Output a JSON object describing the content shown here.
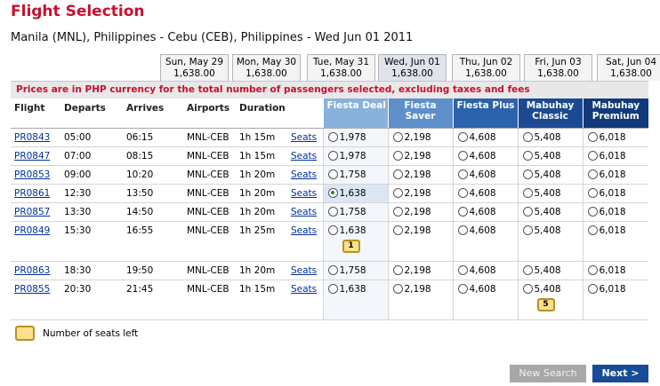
{
  "page": {
    "title": "Flight Selection",
    "route": "Manila (MNL), Philippines - Cebu (CEB), Philippines - Wed Jun 01 2011"
  },
  "date_tabs": [
    {
      "day": "Sun, May 29",
      "price": "1,638.00"
    },
    {
      "day": "Mon, May 30",
      "price": "1,638.00"
    },
    {
      "day": "Tue, May 31",
      "price": "1,638.00"
    },
    {
      "day": "Wed, Jun 01",
      "price": "1,638.00",
      "selected": true
    },
    {
      "day": "Thu, Jun 02",
      "price": "1,638.00"
    },
    {
      "day": "Fri, Jun 03",
      "price": "1,638.00"
    },
    {
      "day": "Sat, Jun 04",
      "price": "1,638.00"
    }
  ],
  "notice": "Prices are in PHP currency for the total number of passengers selected, excluding taxes and fees",
  "columns": {
    "flight": "Flight",
    "departs": "Departs",
    "arrives": "Arrives",
    "airports": "Airports",
    "duration": "Duration",
    "fares": [
      {
        "line1": "Fiesta Deal",
        "line2": "",
        "color": "#8ab0dc"
      },
      {
        "line1": "Fiesta",
        "line2": "Saver",
        "color": "#5e8fcb"
      },
      {
        "line1": "Fiesta Plus",
        "line2": "",
        "color": "#2d62ad"
      },
      {
        "line1": "Mabuhay",
        "line2": "Classic",
        "color": "#1b4a92"
      },
      {
        "line1": "Mabuhay",
        "line2": "Premium",
        "color": "#123a7a"
      }
    ]
  },
  "flights": [
    {
      "flight": "PR0843",
      "departs": "05:00",
      "arrives": "06:15",
      "airports": "MNL-CEB",
      "duration": "1h 15m",
      "seats_label": "Seats",
      "fares": [
        "1,978",
        "2,198",
        "4,608",
        "5,408",
        "6,018"
      ]
    },
    {
      "flight": "PR0847",
      "departs": "07:00",
      "arrives": "08:15",
      "airports": "MNL-CEB",
      "duration": "1h 15m",
      "seats_label": "Seats",
      "fares": [
        "1,978",
        "2,198",
        "4,608",
        "5,408",
        "6,018"
      ]
    },
    {
      "flight": "PR0853",
      "departs": "09:00",
      "arrives": "10:20",
      "airports": "MNL-CEB",
      "duration": "1h 20m",
      "seats_label": "Seats",
      "fares": [
        "1,758",
        "2,198",
        "4,608",
        "5,408",
        "6,018"
      ]
    },
    {
      "flight": "PR0861",
      "departs": "12:30",
      "arrives": "13:50",
      "airports": "MNL-CEB",
      "duration": "1h 20m",
      "seats_label": "Seats",
      "fares": [
        "1,638",
        "2,198",
        "4,608",
        "5,408",
        "6,018"
      ],
      "selected_fare": 0
    },
    {
      "flight": "PR0857",
      "departs": "13:30",
      "arrives": "14:50",
      "airports": "MNL-CEB",
      "duration": "1h 20m",
      "seats_label": "Seats",
      "fares": [
        "1,758",
        "2,198",
        "4,608",
        "5,408",
        "6,018"
      ]
    },
    {
      "flight": "PR0849",
      "departs": "15:30",
      "arrives": "16:55",
      "airports": "MNL-CEB",
      "duration": "1h 25m",
      "seats_label": "Seats",
      "fares": [
        "1,638",
        "2,198",
        "4,608",
        "5,408",
        "6,018"
      ],
      "seats_left": {
        "fare": 0,
        "count": "1"
      }
    },
    {
      "flight": "PR0863",
      "departs": "18:30",
      "arrives": "19:50",
      "airports": "MNL-CEB",
      "duration": "1h 20m",
      "seats_label": "Seats",
      "fares": [
        "1,758",
        "2,198",
        "4,608",
        "5,408",
        "6,018"
      ]
    },
    {
      "flight": "PR0855",
      "departs": "20:30",
      "arrives": "21:45",
      "airports": "MNL-CEB",
      "duration": "1h 15m",
      "seats_label": "Seats",
      "fares": [
        "1,638",
        "2,198",
        "4,608",
        "5,408",
        "6,018"
      ],
      "seats_left": {
        "fare": 3,
        "count": "5"
      }
    }
  ],
  "legend": "Number of seats left",
  "buttons": {
    "new_search": "New Search",
    "next": "Next >"
  }
}
